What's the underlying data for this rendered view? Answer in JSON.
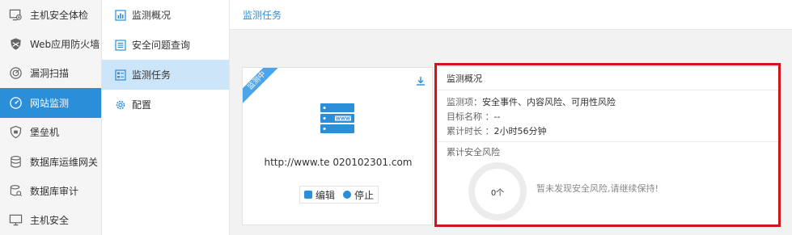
{
  "nav": {
    "items": [
      {
        "label": "主机安全体检",
        "icon": "host-check-icon"
      },
      {
        "label": "Web应用防火墙",
        "icon": "waf-shield-icon"
      },
      {
        "label": "漏洞扫描",
        "icon": "vuln-scan-icon"
      },
      {
        "label": "网站监测",
        "icon": "site-monitor-icon",
        "active": true
      },
      {
        "label": "堡垒机",
        "icon": "bastion-icon"
      },
      {
        "label": "数据库运维网关",
        "icon": "db-gateway-icon"
      },
      {
        "label": "数据库审计",
        "icon": "db-audit-icon"
      },
      {
        "label": "主机安全",
        "icon": "host-security-icon"
      }
    ]
  },
  "subnav": {
    "items": [
      {
        "label": "监测概况",
        "icon": "overview-icon"
      },
      {
        "label": "安全问题查询",
        "icon": "query-list-icon"
      },
      {
        "label": "监测任务",
        "icon": "task-icon",
        "active": true
      },
      {
        "label": "配置",
        "icon": "config-icon"
      }
    ]
  },
  "topbar": {
    "title": "监测任务"
  },
  "card": {
    "ribbon": "监测中",
    "url": "http://www.te    020102301.com",
    "edit_label": "编辑",
    "stop_label": "停止"
  },
  "panel": {
    "title": "监测概况",
    "monitor_items_key": "监测项：",
    "monitor_items_val": "安全事件、内容风险、可用性风险",
    "target_key": "目标名称 ：",
    "target_val": "--",
    "duration_key": "累计时长 ：",
    "duration_val": "2小时56分钟",
    "risk_title": "累计安全风险",
    "risk_count": "0个",
    "ok_message": "暂未发现安全风险,请继续保持!"
  },
  "colors": {
    "accent": "#2b8ed9",
    "highlight": "#d0161b"
  }
}
